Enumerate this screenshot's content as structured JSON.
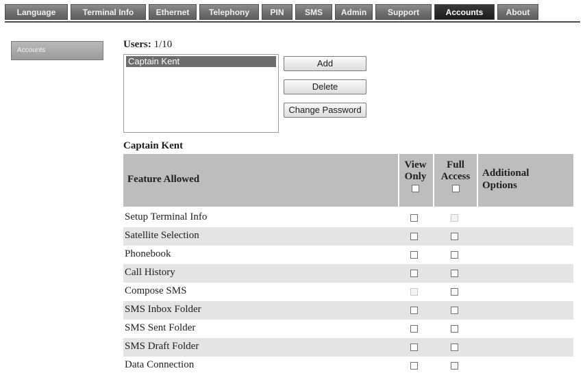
{
  "nav": {
    "tabs": [
      {
        "label": "Language",
        "active": false
      },
      {
        "label": "Terminal Info",
        "active": false
      },
      {
        "label": "Ethernet",
        "active": false
      },
      {
        "label": "Telephony",
        "active": false
      },
      {
        "label": "PIN",
        "active": false
      },
      {
        "label": "SMS",
        "active": false
      },
      {
        "label": "Admin",
        "active": false
      },
      {
        "label": "Support",
        "active": false
      },
      {
        "label": "Accounts",
        "active": true
      },
      {
        "label": "About",
        "active": false
      }
    ]
  },
  "sidebar": {
    "item_label": "Accounts"
  },
  "users": {
    "label": "Users:",
    "count": "1/10",
    "list": [
      "Captain Kent"
    ],
    "selected": "Captain Kent",
    "buttons": {
      "add": "Add",
      "delete": "Delete",
      "change_password": "Change Password"
    }
  },
  "permissions": {
    "user_name": "Captain Kent",
    "headers": {
      "feature": "Feature Allowed",
      "view_line1": "View",
      "view_line2": "Only",
      "full_line1": "Full",
      "full_line2": "Access",
      "additional_line1": "Additional",
      "additional_line2": "Options"
    },
    "rows": [
      {
        "feature": "Setup Terminal Info",
        "view_only": false,
        "full_access": false,
        "full_disabled": true,
        "view_disabled": false
      },
      {
        "feature": "Satellite Selection",
        "view_only": false,
        "full_access": false,
        "full_disabled": false,
        "view_disabled": false
      },
      {
        "feature": "Phonebook",
        "view_only": false,
        "full_access": false,
        "full_disabled": false,
        "view_disabled": false
      },
      {
        "feature": "Call History",
        "view_only": false,
        "full_access": false,
        "full_disabled": false,
        "view_disabled": false
      },
      {
        "feature": "Compose SMS",
        "view_only": false,
        "full_access": false,
        "full_disabled": false,
        "view_disabled": true
      },
      {
        "feature": "SMS Inbox Folder",
        "view_only": false,
        "full_access": false,
        "full_disabled": false,
        "view_disabled": false
      },
      {
        "feature": "SMS Sent Folder",
        "view_only": false,
        "full_access": false,
        "full_disabled": false,
        "view_disabled": false
      },
      {
        "feature": "SMS Draft Folder",
        "view_only": false,
        "full_access": false,
        "full_disabled": false,
        "view_disabled": false
      },
      {
        "feature": "Data Connection",
        "view_only": false,
        "full_access": false,
        "full_disabled": false,
        "view_disabled": false
      }
    ]
  }
}
